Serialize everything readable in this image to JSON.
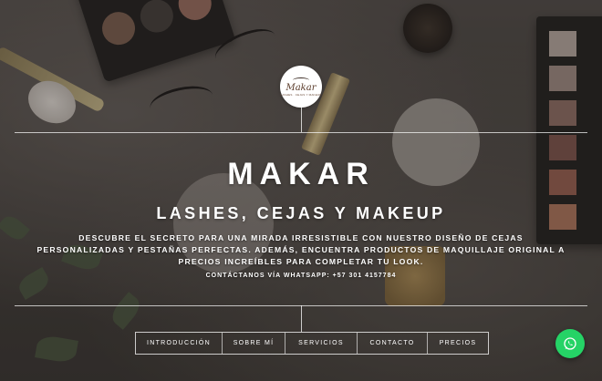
{
  "logo": {
    "word": "Makar",
    "sub": "LASHES · CEJAS Y MAKEUP"
  },
  "hero": {
    "title": "MAKAR",
    "subtitle": "LASHES, CEJAS Y MAKEUP",
    "description": "DESCUBRE EL SECRETO PARA UNA MIRADA IRRESISTIBLE CON NUESTRO DISEÑO DE CEJAS PERSONALIZADAS Y PESTAÑAS PERFECTAS. ADEMÁS, ENCUENTRA PRODUCTOS DE MAQUILLAJE ORIGINAL A PRECIOS INCREÍBLES PARA COMPLETAR TU LOOK.",
    "contact": "CONTÁCTANOS VÍA WHATSAPP: +57 301 4157784"
  },
  "nav": {
    "items": [
      {
        "label": "INTRODUCCIÓN"
      },
      {
        "label": "SOBRE MÍ"
      },
      {
        "label": "SERVICIOS"
      },
      {
        "label": "CONTACTO"
      },
      {
        "label": "PRECIOS"
      }
    ]
  },
  "whatsapp": {
    "icon": "whatsapp-icon",
    "color": "#25d366"
  },
  "colors": {
    "text": "#ffffff",
    "accent": "#25d366"
  }
}
